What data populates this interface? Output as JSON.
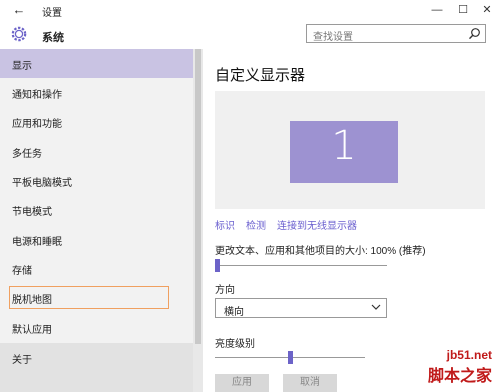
{
  "window": {
    "title": "设置",
    "back_icon": "back-arrow-icon",
    "controls": [
      "minimize",
      "maximize",
      "close"
    ]
  },
  "header": {
    "title": "系统",
    "icon": "gear-icon",
    "search_placeholder": "查找设置"
  },
  "sidebar": {
    "items": [
      {
        "label": "显示",
        "state": "selected"
      },
      {
        "label": "通知和操作"
      },
      {
        "label": "应用和功能"
      },
      {
        "label": "多任务"
      },
      {
        "label": "平板电脑模式"
      },
      {
        "label": "节电模式"
      },
      {
        "label": "电源和睡眠"
      },
      {
        "label": "存储"
      },
      {
        "label": "脱机地图",
        "state": "focused"
      },
      {
        "label": "默认应用"
      },
      {
        "label": "关于"
      }
    ]
  },
  "main": {
    "title": "自定义显示器",
    "monitor_number": "1",
    "links": {
      "identify": "标识",
      "detect": "检测",
      "wireless": "连接到无线显示器"
    },
    "scale_label": "更改文本、应用和其他项目的大小: 100% (推荐)",
    "scale_value_percent": 0,
    "orientation_label": "方向",
    "orientation_value": "横向",
    "brightness_label": "亮度级别",
    "brightness_value_percent": 50,
    "buttons": {
      "apply": "应用",
      "cancel": "取消"
    },
    "accent_color": "#6c63c8"
  },
  "watermark": {
    "url": "jb51.net",
    "text": "脚本之家"
  }
}
